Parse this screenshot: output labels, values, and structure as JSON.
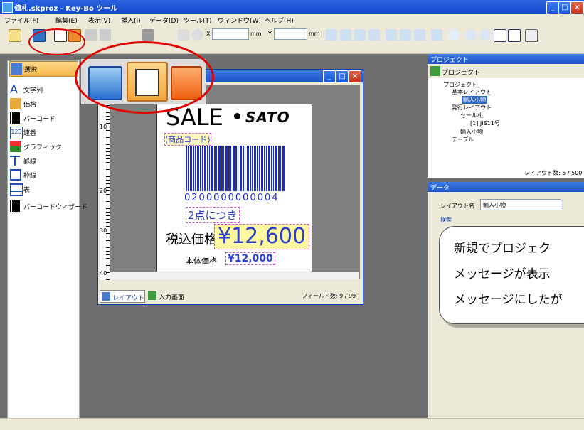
{
  "window": {
    "title": "値札.skproz - Key-Bo ツール"
  },
  "menu": [
    "ファイル(F)",
    "編集(E)",
    "表示(V)",
    "挿入(I)",
    "データ(D)",
    "ツール(T)",
    "ウィンドウ(W)",
    "ヘルプ(H)"
  ],
  "toolbar": {
    "x_label": "X",
    "y_label": "Y",
    "unit_x": "mm",
    "unit_y": "mm"
  },
  "toolbox": [
    {
      "label": "選択",
      "icon": "select-arrow-icon"
    },
    {
      "label": "文字列",
      "icon": "text-icon"
    },
    {
      "label": "価格",
      "icon": "price-icon"
    },
    {
      "label": "バーコード",
      "icon": "barcode-icon"
    },
    {
      "label": "連番",
      "icon": "serial-number-icon"
    },
    {
      "label": "グラフィック",
      "icon": "graphic-icon"
    },
    {
      "label": "罫線",
      "icon": "line-icon"
    },
    {
      "label": "枠線",
      "icon": "frame-icon"
    },
    {
      "label": "表",
      "icon": "table-icon"
    },
    {
      "label": "バーコードウィザード",
      "icon": "barcode-wizard-icon"
    }
  ],
  "label": {
    "sale": "SALE",
    "brand": "SATO",
    "product_code": "(商品コード)",
    "barcode_number": "0200000000004",
    "promo": "2点につき",
    "tax_incl_label": "税込価格",
    "tax_incl_price": "¥12,600",
    "base_label": "本体価格",
    "base_price": "¥12,000"
  },
  "ruler": {
    "h_ticks": [
      "10",
      "20",
      "30",
      "40"
    ],
    "v_ticks": [
      "10",
      "20",
      "30",
      "40"
    ]
  },
  "editor_tabs": {
    "layout": "レイアウト",
    "input": "入力画面",
    "field_count": "フィールド数: 9 / 99"
  },
  "project_pane": {
    "title": "プロジェクト",
    "dropdown": "プロジェクト",
    "tree": [
      {
        "label": "プロジェクト",
        "level": 0
      },
      {
        "label": "基本レイアウト",
        "level": 1
      },
      {
        "label": "輸入小物",
        "level": 2,
        "selected": true
      },
      {
        "label": "発行レイアウト",
        "level": 1
      },
      {
        "label": "セール札",
        "level": 2
      },
      {
        "label": "[1] JIS11号",
        "level": 3
      },
      {
        "label": "輸入小物",
        "level": 2
      },
      {
        "label": "テーブル",
        "level": 1
      }
    ],
    "layout_count": "レイアウト数: 5 / 500"
  },
  "data_pane": {
    "title": "データ",
    "layout_name_label": "レイアウト名",
    "layout_name_value": "輸入小物",
    "search_label": "検索"
  },
  "callout": {
    "lines": [
      "新規でプロジェク",
      "メッセージが表示",
      "メッセージにしたが"
    ]
  }
}
